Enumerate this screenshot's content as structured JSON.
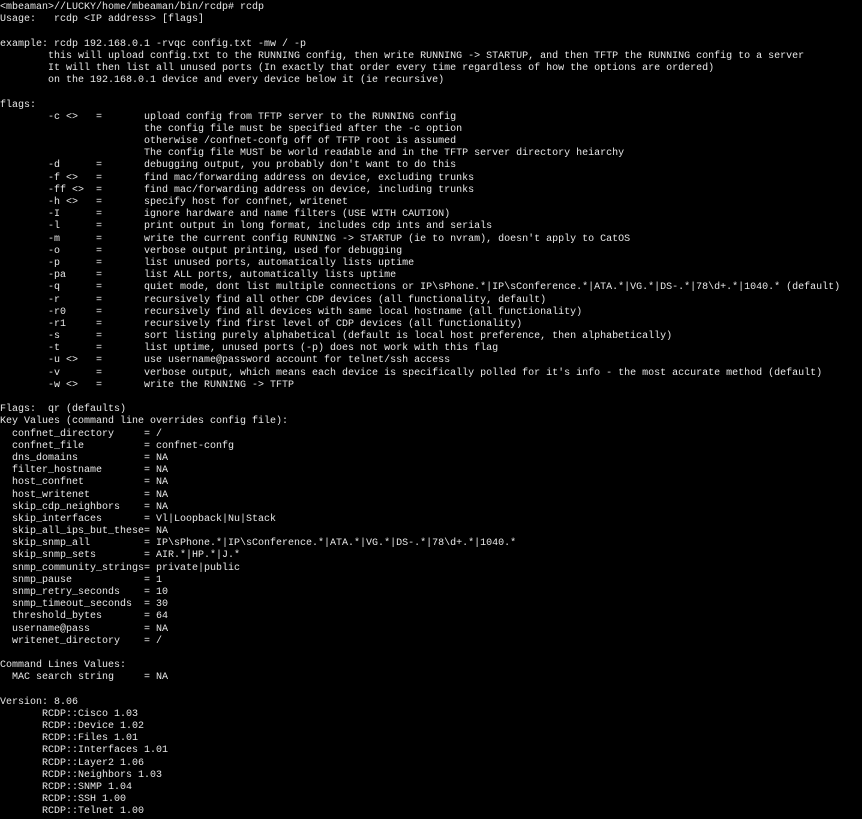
{
  "terminal": {
    "background": "#000000",
    "foreground": "#e8e8e8",
    "lines": [
      "<mbeaman>//LUCKY/home/mbeaman/bin/rcdp# rcdp",
      "Usage:   rcdp <IP address> [flags]",
      "",
      "example: rcdp 192.168.0.1 -rvqc config.txt -mw / -p",
      "        this will upload config.txt to the RUNNING config, then write RUNNING -> STARTUP, and then TFTP the RUNNING config to a server",
      "        It will then list all unused ports (In exactly that order every time regardless of how the options are ordered)",
      "        on the 192.168.0.1 device and every device below it (ie recursive)",
      "",
      "flags:",
      "        -c <>   =       upload config from TFTP server to the RUNNING config",
      "                        the config file must be specified after the -c option",
      "                        otherwise /confnet-confg off of TFTP root is assumed",
      "                        The config file MUST be world readable and in the TFTP server directory heiarchy",
      "        -d      =       debugging output, you probably don't want to do this",
      "        -f <>   =       find mac/forwarding address on device, excluding trunks",
      "        -ff <>  =       find mac/forwarding address on device, including trunks",
      "        -h <>   =       specify host for confnet, writenet",
      "        -I      =       ignore hardware and name filters (USE WITH CAUTION)",
      "        -l      =       print output in long format, includes cdp ints and serials",
      "        -m      =       write the current config RUNNING -> STARTUP (ie to nvram), doesn't apply to CatOS",
      "        -o      =       verbose output printing, used for debugging",
      "        -p      =       list unused ports, automatically lists uptime",
      "        -pa     =       list ALL ports, automatically lists uptime",
      "        -q      =       quiet mode, dont list multiple connections or IP\\sPhone.*|IP\\sConference.*|ATA.*|VG.*|DS-.*|78\\d+.*|1040.* (default)",
      "        -r      =       recursively find all other CDP devices (all functionality, default)",
      "        -r0     =       recursively find all devices with same local hostname (all functionality)",
      "        -r1     =       recursively find first level of CDP devices (all functionality)",
      "        -s      =       sort listing purely alphabetical (default is local host preference, then alphabetically)",
      "        -t      =       list uptime, unused ports (-p) does not work with this flag",
      "        -u <>   =       use username@password account for telnet/ssh access",
      "        -v      =       verbose output, which means each device is specifically polled for it's info - the most accurate method (default)",
      "        -w <>   =       write the RUNNING -> TFTP",
      "",
      "Flags:  qr (defaults)",
      "Key Values (command line overrides config file):",
      "  confnet_directory     = /",
      "  confnet_file          = confnet-confg",
      "  dns_domains           = NA",
      "  filter_hostname       = NA",
      "  host_confnet          = NA",
      "  host_writenet         = NA",
      "  skip_cdp_neighbors    = NA",
      "  skip_interfaces       = Vl|Loopback|Nu|Stack",
      "  skip_all_ips_but_these= NA",
      "  skip_snmp_all         = IP\\sPhone.*|IP\\sConference.*|ATA.*|VG.*|DS-.*|78\\d+.*|1040.*",
      "  skip_snmp_sets        = AIR.*|HP.*|J.*",
      "  snmp_community_strings= private|public",
      "  snmp_pause            = 1",
      "  snmp_retry_seconds    = 10",
      "  snmp_timeout_seconds  = 30",
      "  threshold_bytes       = 64",
      "  username@pass         = NA",
      "  writenet_directory    = /",
      "",
      "Command Lines Values:",
      "  MAC search string     = NA",
      "",
      "Version: 8.06",
      "       RCDP::Cisco 1.03",
      "       RCDP::Device 1.02",
      "       RCDP::Files 1.01",
      "       RCDP::Interfaces 1.01",
      "       RCDP::Layer2 1.06",
      "       RCDP::Neighbors 1.03",
      "       RCDP::SNMP 1.04",
      "       RCDP::SSH 1.00",
      "       RCDP::Telnet 1.00"
    ]
  }
}
